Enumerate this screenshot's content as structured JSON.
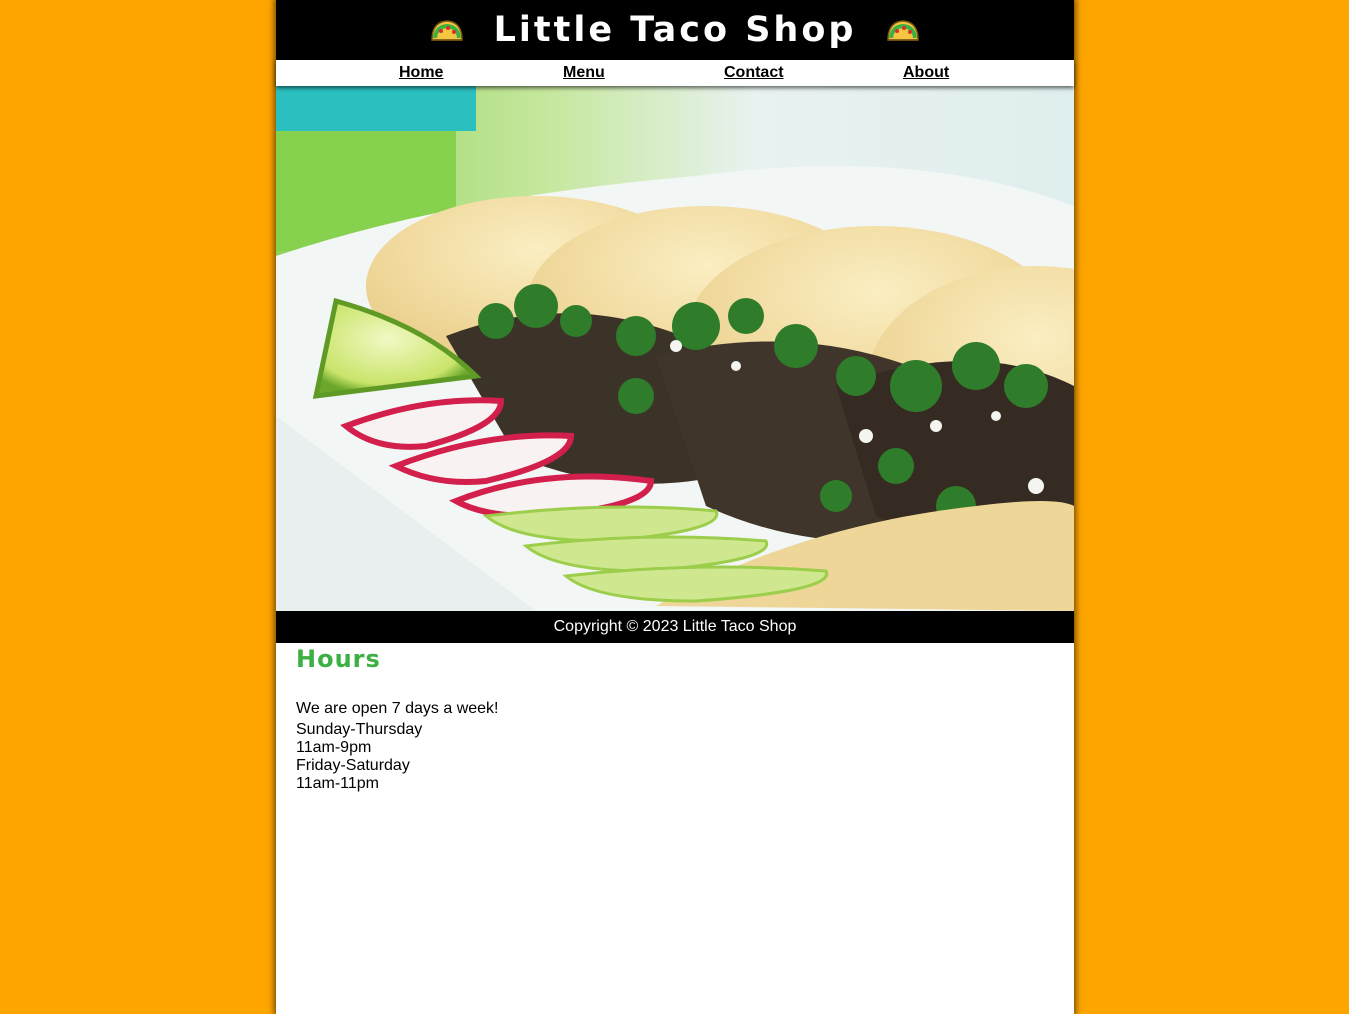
{
  "header": {
    "title": "Little Taco Shop",
    "icon_left": "taco-icon",
    "icon_right": "taco-icon"
  },
  "nav": {
    "items": [
      {
        "label": "Home"
      },
      {
        "label": "Menu"
      },
      {
        "label": "Contact"
      },
      {
        "label": "About"
      }
    ]
  },
  "hero": {
    "image": "tacos-photo"
  },
  "footer": {
    "copyright": "Copyright © 2023 Little Taco Shop"
  },
  "hours": {
    "title": "Hours",
    "intro": "We are open 7 days a week!",
    "lines": [
      "Sunday-Thursday",
      "11am-9pm",
      "Friday-Saturday",
      "11am-11pm"
    ]
  },
  "colors": {
    "background": "#FFA500",
    "header_bg": "#000000",
    "hours_title": "#3CB043"
  }
}
